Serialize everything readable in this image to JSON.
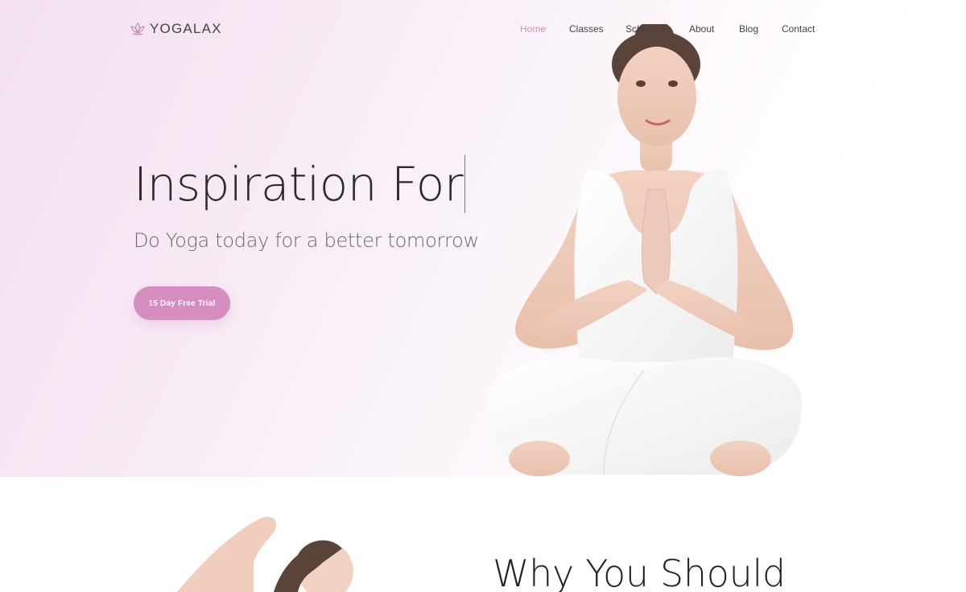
{
  "brand": {
    "name": "YOGALAX",
    "logo_icon": "lotus-icon",
    "accent": "#d68dc0"
  },
  "nav": [
    {
      "label": "Home",
      "active": true
    },
    {
      "label": "Classes",
      "active": false
    },
    {
      "label": "Schedule",
      "active": false
    },
    {
      "label": "About",
      "active": false
    },
    {
      "label": "Blog",
      "active": false
    },
    {
      "label": "Contact",
      "active": false
    }
  ],
  "hero": {
    "headline": "Inspiration For",
    "subheadline": "Do Yoga today for a better tomorrow",
    "cta_label": "15 Day Free Trial"
  },
  "section": {
    "title": "Why You Should"
  }
}
